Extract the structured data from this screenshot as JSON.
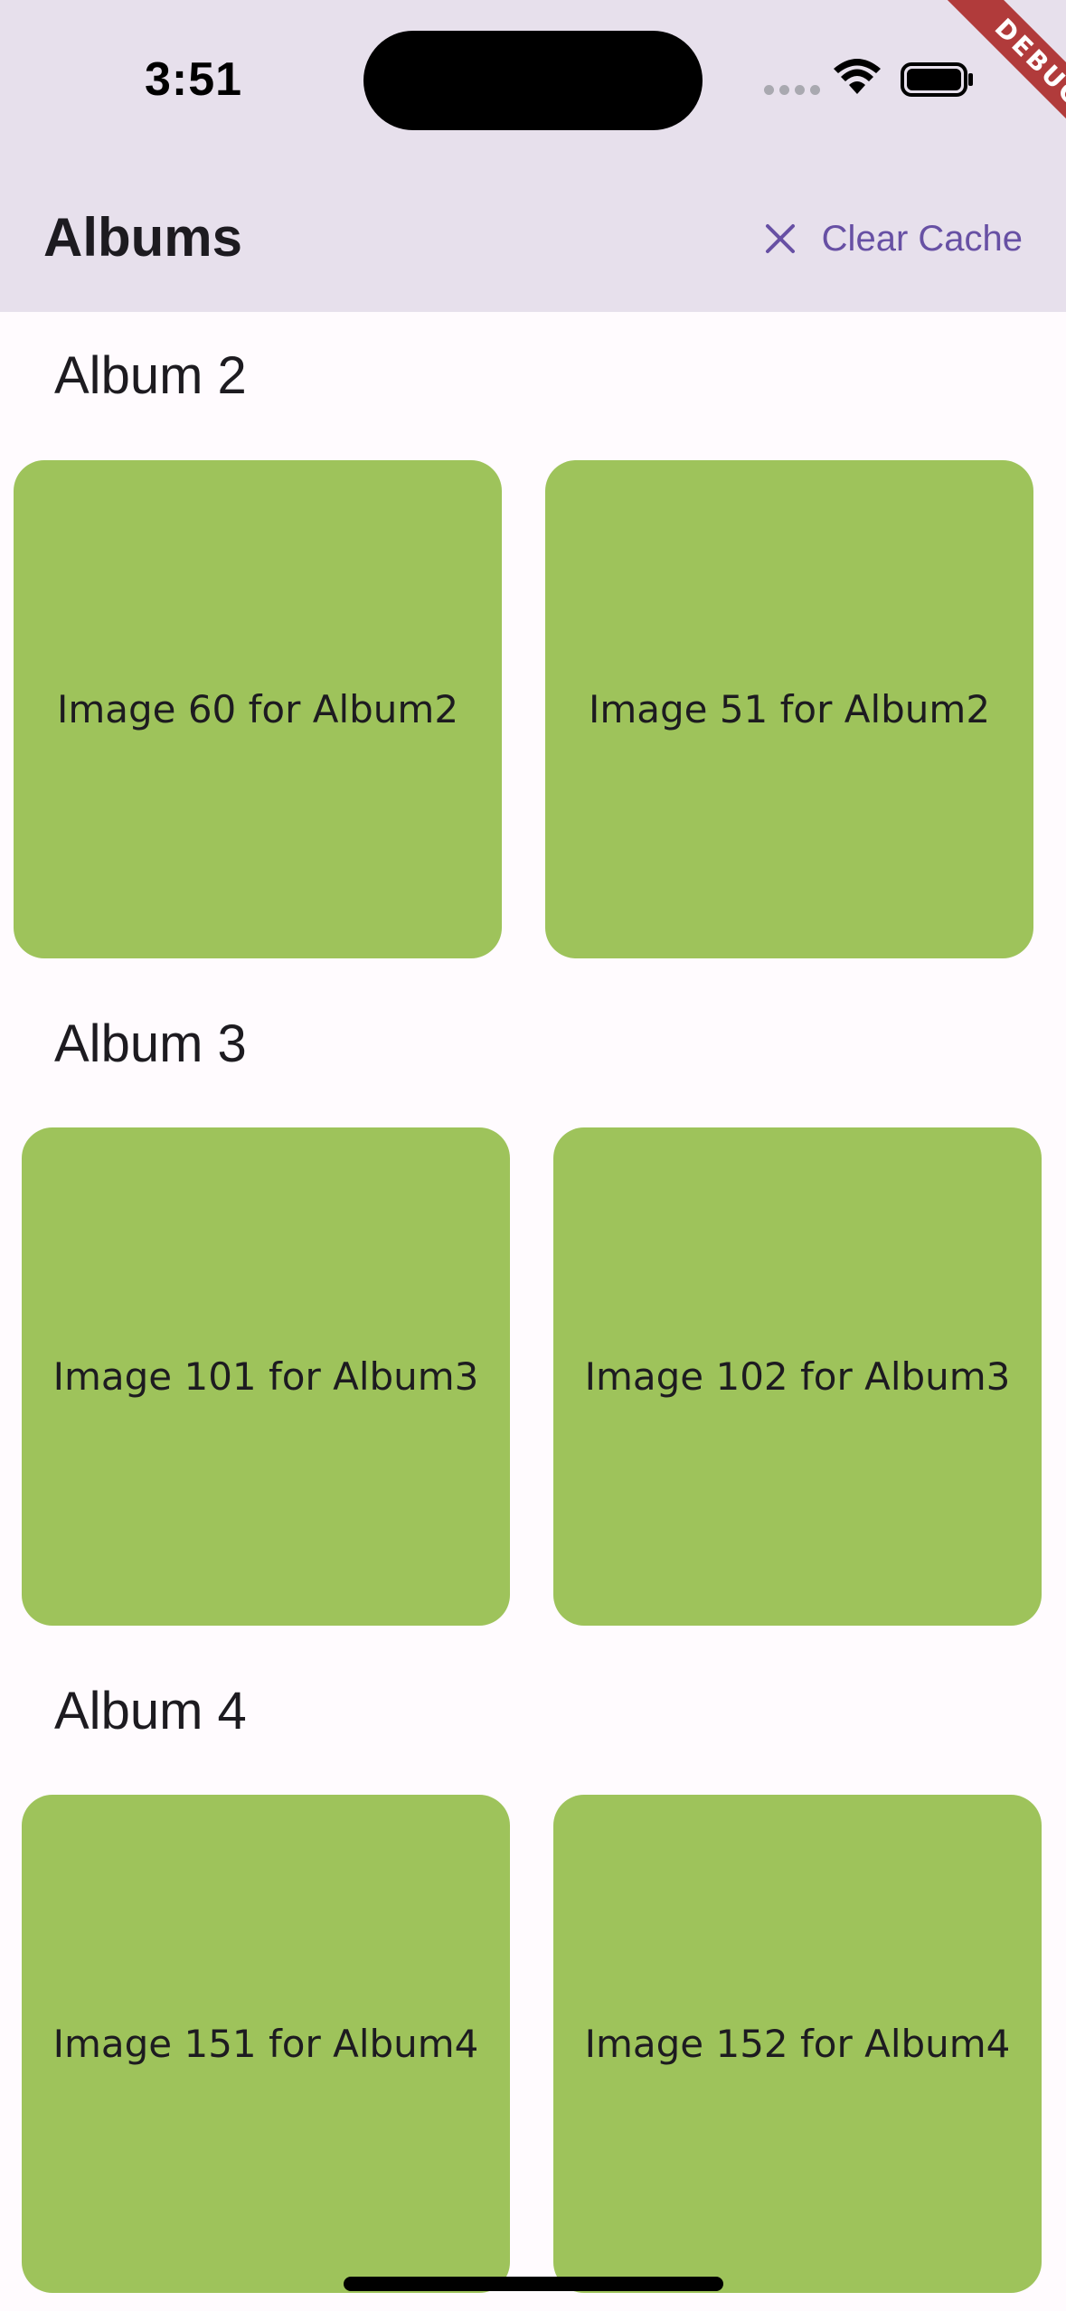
{
  "status_bar": {
    "time": "3:51",
    "debug_label": "DEBUG"
  },
  "app_bar": {
    "title": "Albums",
    "action_label": "Clear Cache",
    "action_icon": "close-icon",
    "accent_color": "#6750a4"
  },
  "albums": [
    {
      "name": "Album 2",
      "images": [
        "Image 60 for Album2",
        "Image 51 for Album2"
      ]
    },
    {
      "name": "Album 3",
      "images": [
        "Image 101 for Album3",
        "Image 102 for Album3"
      ]
    },
    {
      "name": "Album 4",
      "images": [
        "Image 151 for Album4",
        "Image 152 for Album4"
      ]
    }
  ],
  "colors": {
    "tile": "#9ec35b",
    "app_bar": "#e7e0ec",
    "background": "#fffbfe"
  }
}
